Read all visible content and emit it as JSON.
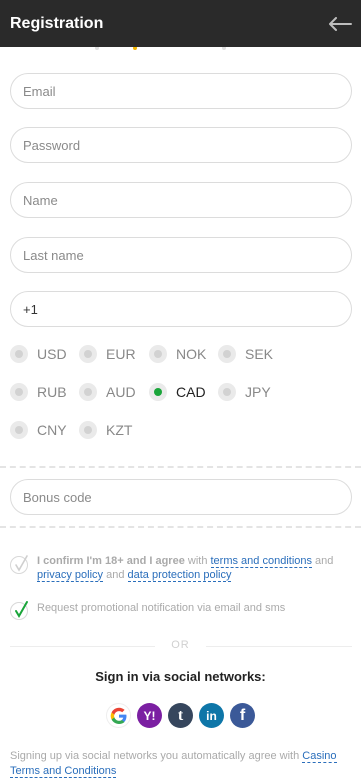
{
  "header": {
    "title": "Registration"
  },
  "form": {
    "email_placeholder": "Email",
    "password_placeholder": "Password",
    "name_placeholder": "Name",
    "lastname_placeholder": "Last name",
    "phone_value": "+1",
    "bonus_placeholder": "Bonus code"
  },
  "currencies": [
    "USD",
    "EUR",
    "NOK",
    "SEK",
    "RUB",
    "AUD",
    "CAD",
    "JPY",
    "CNY",
    "KZT"
  ],
  "selected_currency": "CAD",
  "consent": {
    "bold_text": "I confirm I'm 18+ and I agree",
    "with_text": " with ",
    "terms_link": "terms and conditions",
    "and1": " and ",
    "privacy_link": "privacy policy",
    "and2": " and ",
    "data_link": "data protection policy"
  },
  "promo": {
    "text": "Request promotional notification via email and sms"
  },
  "or_text": "OR",
  "social": {
    "title": "Sign in via social networks:",
    "networks": [
      {
        "name": "google-icon",
        "glyph": "G",
        "color": "#ffffff"
      },
      {
        "name": "yahoo-icon",
        "glyph": "Y!",
        "color": "#7b1fa2"
      },
      {
        "name": "tumblr-icon",
        "glyph": "t",
        "color": "#36465d"
      },
      {
        "name": "linkedin-icon",
        "glyph": "in",
        "color": "#0e76a8"
      },
      {
        "name": "facebook-icon",
        "glyph": "f",
        "color": "#3b5998"
      }
    ]
  },
  "terms_note": {
    "text": "Signing up via social networks you automatically agree with ",
    "link": "Casino Terms and Conditions"
  },
  "colors": {
    "header_bg": "#2a2a2a",
    "accent_green": "#1aa53a",
    "link_blue": "#2a6ebb"
  }
}
